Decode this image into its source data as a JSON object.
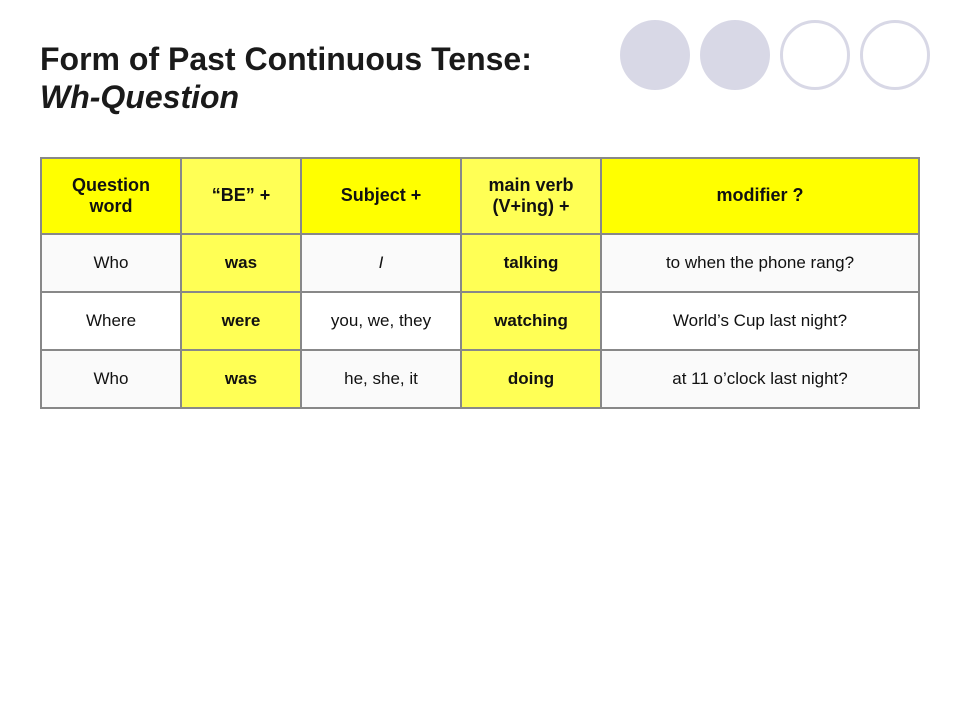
{
  "page": {
    "title_line1": "Form of Past Continuous Tense:",
    "title_line2": "Wh-Question"
  },
  "table": {
    "headers": [
      {
        "id": "question-word",
        "text": "Question word"
      },
      {
        "id": "be",
        "text": "“BE” +"
      },
      {
        "id": "subject",
        "text": "Subject +"
      },
      {
        "id": "main-verb",
        "text": "main verb (V+ing) +"
      },
      {
        "id": "modifier",
        "text": "modifier ?"
      }
    ],
    "rows": [
      {
        "question_word": "Who",
        "be": "was",
        "subject": "I",
        "main_verb": "talking",
        "modifier": "to when the phone rang?"
      },
      {
        "question_word": "Where",
        "be": "were",
        "subject": "you, we, they",
        "main_verb": "watching",
        "modifier": "World’s Cup last night?"
      },
      {
        "question_word": "Who",
        "be": "was",
        "subject": "he, she, it",
        "main_verb": "doing",
        "modifier": "at 11 o’clock last night?"
      }
    ]
  }
}
